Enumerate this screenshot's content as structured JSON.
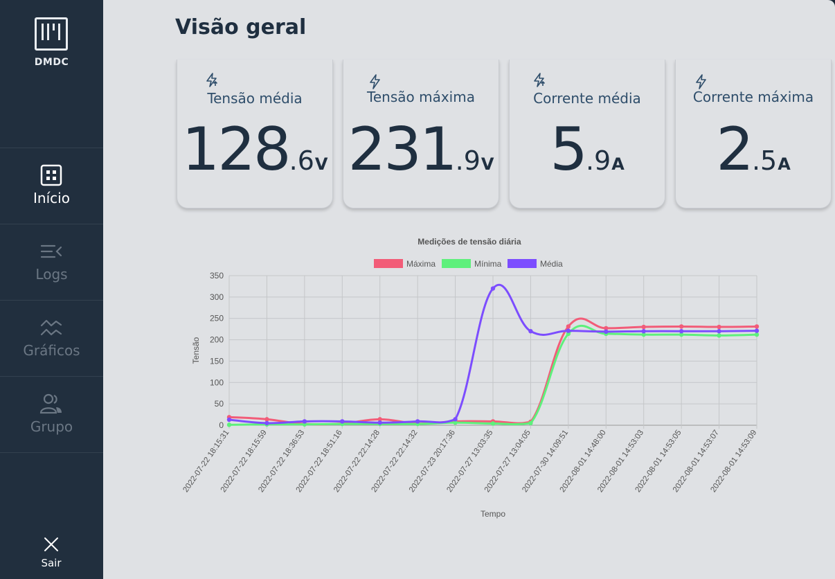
{
  "sidebar": {
    "logo_text": "DMDC",
    "items": [
      {
        "label": "Início",
        "icon": "grid-icon",
        "active": true
      },
      {
        "label": "Logs",
        "icon": "list-collapse-icon",
        "active": false
      },
      {
        "label": "Gráficos",
        "icon": "line-chart-icon",
        "active": false
      },
      {
        "label": "Grupo",
        "icon": "users-icon",
        "active": false
      }
    ],
    "logout_label": "Sair"
  },
  "main": {
    "title": "Visão geral",
    "cards": [
      {
        "label": "Tensão média",
        "int": "128",
        "dec": ".6",
        "unit": "V",
        "icon": "lightning-arrow-icon"
      },
      {
        "label": "Tensão máxima",
        "int": "231",
        "dec": ".9",
        "unit": "V",
        "icon": "lightning-icon"
      },
      {
        "label": "Corrente média",
        "int": "5",
        "dec": ".9",
        "unit": "A",
        "icon": "lightning-arrow-icon"
      },
      {
        "label": "Corrente máxima",
        "int": "2",
        "dec": ".5",
        "unit": "A",
        "icon": "lightning-icon"
      }
    ]
  },
  "colors": {
    "sidebar": "#212f3e",
    "main_bg": "#dfe1e4",
    "text_dark": "#1f2f40",
    "label_blue": "#2e4d6a"
  },
  "chart_data": {
    "type": "line",
    "title": "Medições de tensão diária",
    "xlabel": "Tempo",
    "ylabel": "Tensão",
    "ylim": [
      0,
      350
    ],
    "yticks": [
      0,
      50,
      100,
      150,
      200,
      250,
      300,
      350
    ],
    "grid": true,
    "legend_position": "top",
    "x": [
      "2022-07-22 18:15:31",
      "2022-07-22 18:15:59",
      "2022-07-22 18:36:53",
      "2022-07-22 18:51:16",
      "2022-07-22 22:14:28",
      "2022-07-22 22:14:32",
      "2022-07-23 20:17:36",
      "2022-07-27 13:03:35",
      "2022-07-27 13:04:05",
      "2022-07-30 14:09:51",
      "2022-08-01 14:48:00",
      "2022-08-01 14:53:03",
      "2022-08-01 14:53:05",
      "2022-08-01 14:53:07",
      "2022-08-01 14:53:09"
    ],
    "series": [
      {
        "name": "Máxima",
        "color": "#f25c78",
        "values": [
          19,
          14,
          3,
          4,
          14,
          4,
          9,
          9,
          8,
          231,
          227,
          230,
          231,
          230,
          231
        ]
      },
      {
        "name": "Mínima",
        "color": "#5ef07c",
        "values": [
          1,
          2,
          2,
          3,
          3,
          3,
          6,
          4,
          5,
          214,
          214,
          212,
          212,
          210,
          212
        ]
      },
      {
        "name": "Média",
        "color": "#7c4dff",
        "values": [
          13,
          5,
          9,
          9,
          6,
          9,
          14,
          320,
          220,
          221,
          219,
          220,
          220,
          220,
          221
        ]
      }
    ]
  }
}
